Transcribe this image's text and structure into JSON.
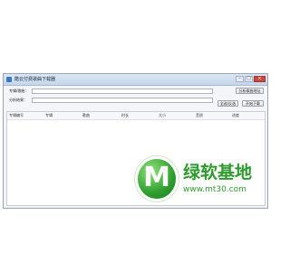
{
  "window": {
    "title": "酷云付费歌曲下载器",
    "minimize_label": "–",
    "maximize_label": "□",
    "close_label": "×"
  },
  "form": {
    "song_label": "专辑/歌曲：",
    "song_value": "",
    "analyze_button": "分析歌曲地址",
    "result_label": "分析结果：",
    "result_value": "",
    "select_all_button": "全选/反选",
    "download_button": "开始下载"
  },
  "table": {
    "columns": [
      "专辑编号",
      "专辑",
      "歌曲",
      "时长",
      "大小",
      "音质",
      "进度"
    ]
  },
  "watermark": {
    "letter": "M",
    "text": "绿软基地",
    "url": "www.mt30.com"
  }
}
